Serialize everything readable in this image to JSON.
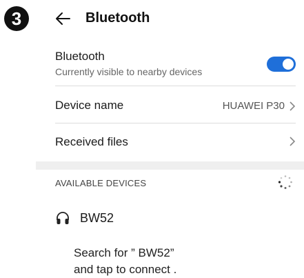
{
  "step_badge": "3",
  "header": {
    "title": "Bluetooth"
  },
  "bluetooth_row": {
    "title": "Bluetooth",
    "subtitle": "Currently visible to nearby devices",
    "enabled": true
  },
  "device_name_row": {
    "title": "Device name",
    "value": "HUAWEI P30"
  },
  "received_files_row": {
    "title": "Received files"
  },
  "available_devices": {
    "header": "AVAILABLE DEVICES",
    "devices": [
      {
        "name": "BW52",
        "icon": "headphones-icon"
      }
    ]
  },
  "instruction": {
    "line1": "Search for ” BW52”",
    "line2": "and tap  to connect ."
  },
  "colors": {
    "accent": "#1f6fd9",
    "divider": "#dcdcdc",
    "band": "#efefef"
  }
}
